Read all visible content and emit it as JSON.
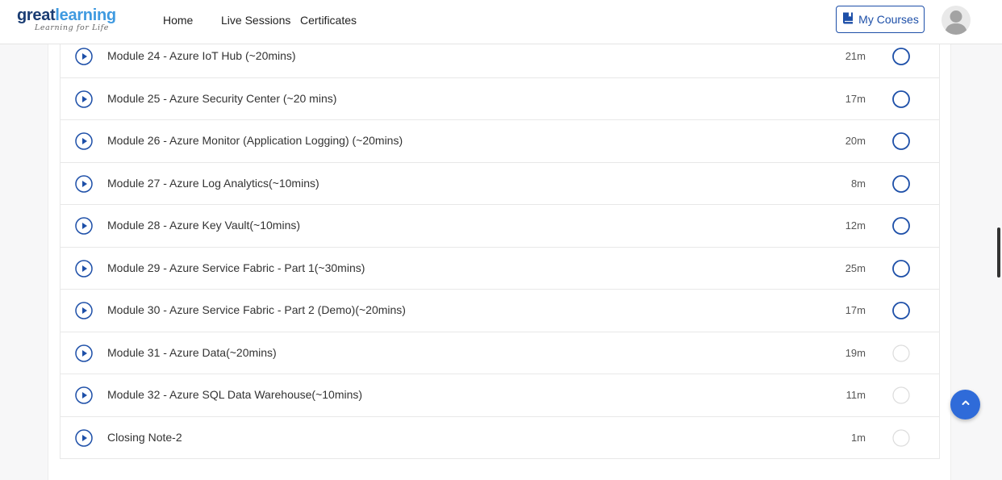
{
  "header": {
    "logo": {
      "brand_part1": "great",
      "brand_part2": "learning",
      "tagline": "Learning for Life"
    },
    "nav": [
      {
        "label": "Home"
      },
      {
        "label": "Live Sessions"
      },
      {
        "label": "Certificates"
      }
    ],
    "my_courses_label": "My Courses"
  },
  "modules": [
    {
      "title": "Module 24 - Azure IoT Hub (~20mins)",
      "duration": "21m",
      "status": "available"
    },
    {
      "title": "Module 25 - Azure Security Center (~20 mins)",
      "duration": "17m",
      "status": "available"
    },
    {
      "title": "Module 26 - Azure Monitor (Application Logging) (~20mins)",
      "duration": "20m",
      "status": "available"
    },
    {
      "title": "Module 27 - Azure Log Analytics(~10mins)",
      "duration": "8m",
      "status": "available"
    },
    {
      "title": "Module 28 - Azure Key Vault(~10mins)",
      "duration": "12m",
      "status": "available"
    },
    {
      "title": "Module 29 - Azure Service Fabric - Part 1(~30mins)",
      "duration": "25m",
      "status": "available"
    },
    {
      "title": "Module 30 - Azure Service Fabric - Part 2 (Demo)(~20mins)",
      "duration": "17m",
      "status": "available"
    },
    {
      "title": "Module 31 - Azure Data(~20mins)",
      "duration": "19m",
      "status": "unavailable"
    },
    {
      "title": "Module 32 - Azure SQL Data Warehouse(~10mins)",
      "duration": "11m",
      "status": "unavailable"
    },
    {
      "title": "Closing Note-2",
      "duration": "1m",
      "status": "unavailable"
    }
  ],
  "colors": {
    "accent": "#1d4fa8",
    "status_ring_available": "#1d4fa8",
    "status_ring_unavailable": "#dcdcdc",
    "back_to_top": "#2f6bd9"
  },
  "icons": {
    "play": "play-circle-icon",
    "status": "circle-outline-icon",
    "my_courses": "book-icon",
    "back_to_top": "chevron-up-icon",
    "avatar": "user-avatar-icon"
  }
}
